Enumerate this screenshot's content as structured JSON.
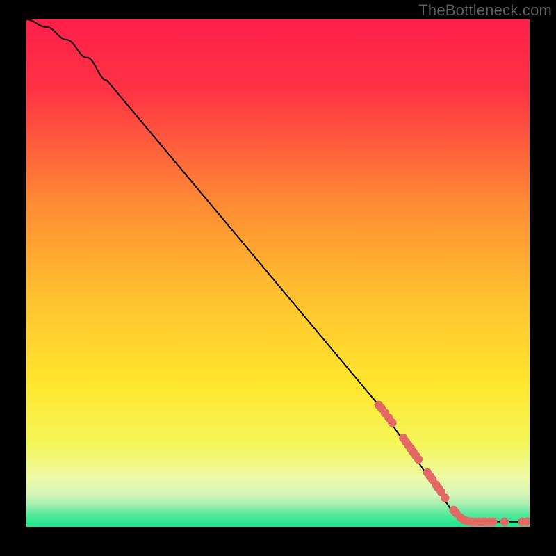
{
  "watermark": "TheBottleneck.com",
  "colors": {
    "black": "#000000",
    "curve": "#000000",
    "dots": "#e36a64",
    "gradient_top": "#ff1f4b",
    "gradient_yellow": "#ffe62e",
    "gradient_green": "#17e88c"
  },
  "chart_data": {
    "type": "line",
    "title": "",
    "xlabel": "",
    "ylabel": "",
    "xlim": [
      0,
      100
    ],
    "ylim": [
      0,
      100
    ],
    "series": [
      {
        "name": "curve",
        "points": [
          {
            "x": 0,
            "y": 100
          },
          {
            "x": 4,
            "y": 98.5
          },
          {
            "x": 8,
            "y": 96
          },
          {
            "x": 12,
            "y": 92.5
          },
          {
            "x": 16,
            "y": 88
          },
          {
            "x": 70,
            "y": 24
          },
          {
            "x": 84,
            "y": 4
          },
          {
            "x": 86,
            "y": 2
          },
          {
            "x": 88,
            "y": 1
          },
          {
            "x": 100,
            "y": 1
          }
        ]
      }
    ],
    "scatter_points": [
      {
        "x": 70.0,
        "y": 24.0
      },
      {
        "x": 70.6,
        "y": 23.3
      },
      {
        "x": 71.3,
        "y": 22.4
      },
      {
        "x": 72.0,
        "y": 21.5
      },
      {
        "x": 72.7,
        "y": 20.5
      },
      {
        "x": 74.9,
        "y": 17.5
      },
      {
        "x": 75.4,
        "y": 16.8
      },
      {
        "x": 75.9,
        "y": 16.1
      },
      {
        "x": 76.4,
        "y": 15.4
      },
      {
        "x": 76.9,
        "y": 14.7
      },
      {
        "x": 77.4,
        "y": 14.0
      },
      {
        "x": 77.9,
        "y": 13.3
      },
      {
        "x": 79.7,
        "y": 10.7
      },
      {
        "x": 80.2,
        "y": 10.0
      },
      {
        "x": 80.7,
        "y": 9.3
      },
      {
        "x": 81.4,
        "y": 8.3
      },
      {
        "x": 81.9,
        "y": 7.6
      },
      {
        "x": 82.4,
        "y": 6.9
      },
      {
        "x": 83.2,
        "y": 5.7
      },
      {
        "x": 84.9,
        "y": 3.3
      },
      {
        "x": 85.4,
        "y": 2.7
      },
      {
        "x": 86.3,
        "y": 1.8
      },
      {
        "x": 87.0,
        "y": 1.3
      },
      {
        "x": 87.7,
        "y": 1.1
      },
      {
        "x": 88.5,
        "y": 1.0
      },
      {
        "x": 89.2,
        "y": 1.0
      },
      {
        "x": 89.9,
        "y": 1.0
      },
      {
        "x": 90.6,
        "y": 1.0
      },
      {
        "x": 91.3,
        "y": 1.0
      },
      {
        "x": 92.0,
        "y": 1.0
      },
      {
        "x": 92.7,
        "y": 1.0
      },
      {
        "x": 95.0,
        "y": 1.0
      },
      {
        "x": 98.5,
        "y": 1.0
      },
      {
        "x": 99.5,
        "y": 1.0
      }
    ],
    "gradient_stops": [
      {
        "offset": 0.0,
        "color": "#ff1f4b"
      },
      {
        "offset": 0.14,
        "color": "#ff3344"
      },
      {
        "offset": 0.36,
        "color": "#ff8a34"
      },
      {
        "offset": 0.55,
        "color": "#ffc22f"
      },
      {
        "offset": 0.72,
        "color": "#ffe62e"
      },
      {
        "offset": 0.84,
        "color": "#f4f65a"
      },
      {
        "offset": 0.905,
        "color": "#eef9a8"
      },
      {
        "offset": 0.935,
        "color": "#d6f5b8"
      },
      {
        "offset": 0.955,
        "color": "#a8efb0"
      },
      {
        "offset": 0.975,
        "color": "#57e99a"
      },
      {
        "offset": 1.0,
        "color": "#17e88c"
      }
    ]
  }
}
